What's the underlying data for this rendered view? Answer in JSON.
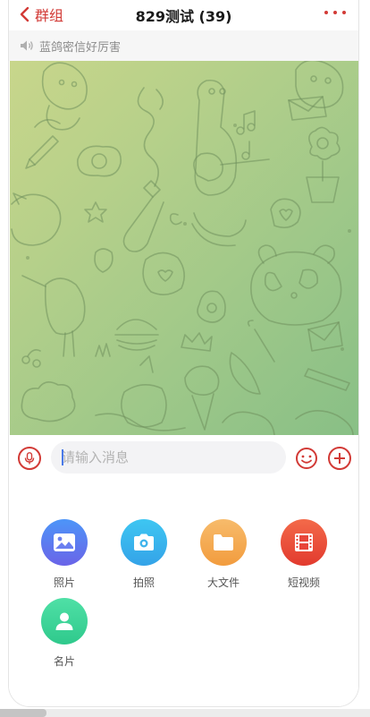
{
  "header": {
    "back_label": "群组",
    "title": "829测试 (39)",
    "more_icon": "more-horizontal-icon",
    "accent_color": "#d23a36"
  },
  "announcement": {
    "icon": "speaker-icon",
    "text": "蓝鸽密信好厉害"
  },
  "input_bar": {
    "placeholder": "请输入消息",
    "voice_icon": "microphone-icon",
    "emoji_icon": "emoji-icon",
    "plus_icon": "plus-icon"
  },
  "actions": [
    {
      "label": "照片",
      "icon": "image-icon",
      "color": "#5b7cf0"
    },
    {
      "label": "拍照",
      "icon": "camera-icon",
      "color": "#3fb6ee"
    },
    {
      "label": "大文件",
      "icon": "folder-icon",
      "color": "#f5a94a"
    },
    {
      "label": "短视频",
      "icon": "film-icon",
      "color": "#ec5038"
    },
    {
      "label": "名片",
      "icon": "contact-card-icon",
      "color": "#38d39a"
    }
  ]
}
